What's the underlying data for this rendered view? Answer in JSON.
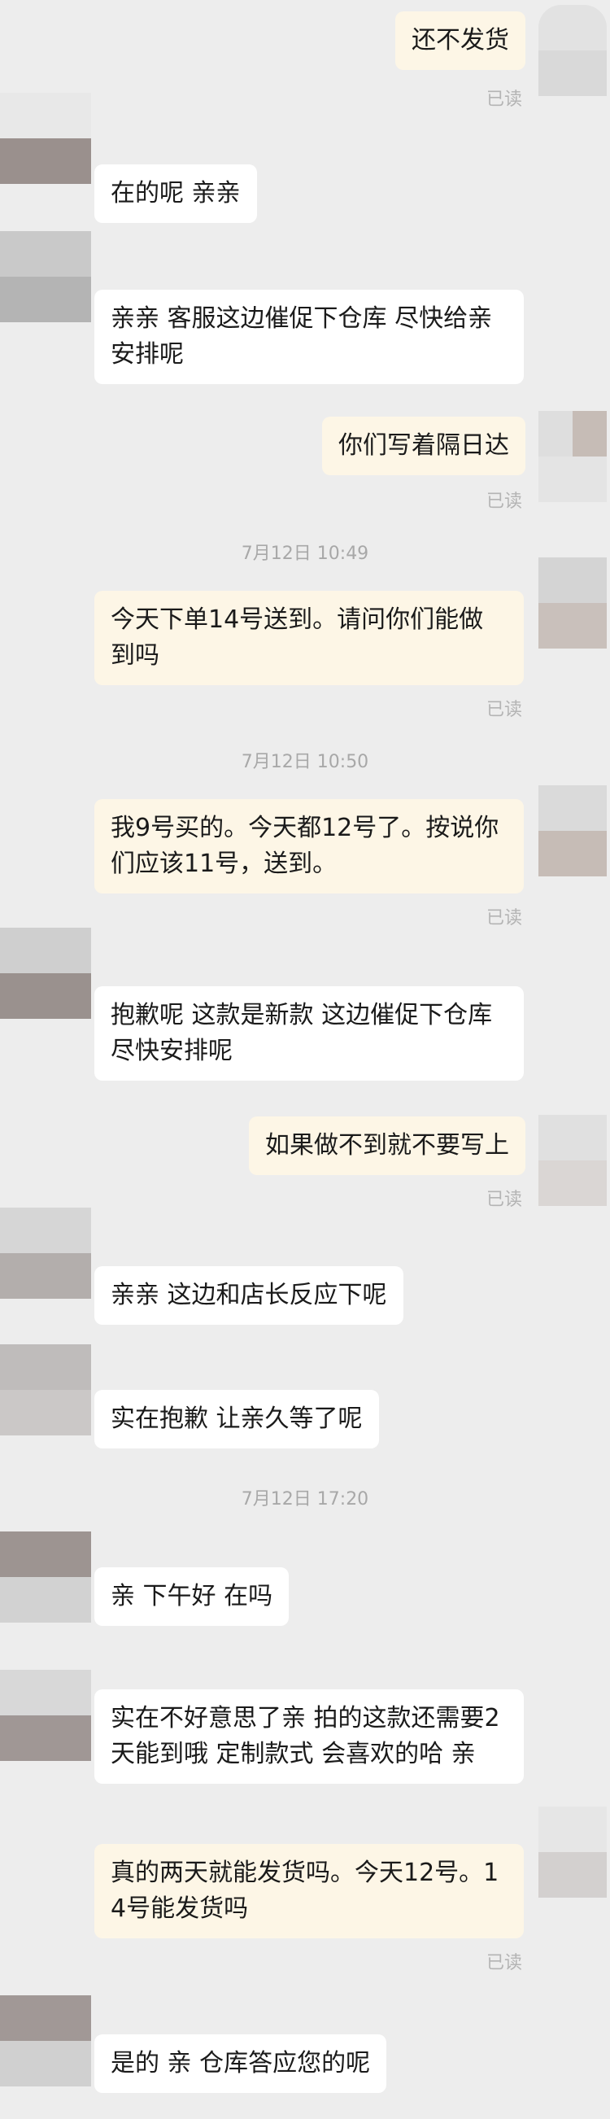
{
  "chat": {
    "read_label": "已读",
    "timestamps": [
      "7月12日 10:49",
      "7月12日 10:50",
      "7月12日 17:20"
    ],
    "messages": [
      {
        "from": "me",
        "text": "还不发货"
      },
      {
        "from": "shop",
        "text": "在的呢 亲亲"
      },
      {
        "from": "shop",
        "text": "亲亲  客服这边催促下仓库 尽快给亲安排呢"
      },
      {
        "from": "me",
        "text": "你们写着隔日达"
      },
      {
        "from": "me",
        "text": "今天下单14号送到。请问你们能做到吗"
      },
      {
        "from": "me",
        "text": "我9号买的。今天都12号了。按说你们应该11号，送到。"
      },
      {
        "from": "shop",
        "text": "抱歉呢 这款是新款  这边催促下仓库尽快安排呢"
      },
      {
        "from": "me",
        "text": "如果做不到就不要写上"
      },
      {
        "from": "shop",
        "text": "亲亲  这边和店长反应下呢"
      },
      {
        "from": "shop",
        "text": "实在抱歉  让亲久等了呢"
      },
      {
        "from": "shop",
        "text": "亲 下午好 在吗"
      },
      {
        "from": "shop",
        "text": "实在不好意思了亲 拍的这款还需要2天能到哦  定制款式 会喜欢的哈 亲"
      },
      {
        "from": "me",
        "text": "真的两天就能发货吗。今天12号。14号能发货吗"
      },
      {
        "from": "shop",
        "text": "是的 亲  仓库答应您的呢"
      }
    ]
  },
  "colors": {
    "background": "#ededed",
    "incoming_bubble": "#ffffff",
    "outgoing_bubble": "#fdf6e6",
    "text": "#1a1a1a",
    "meta_text": "#b4b4b4"
  }
}
